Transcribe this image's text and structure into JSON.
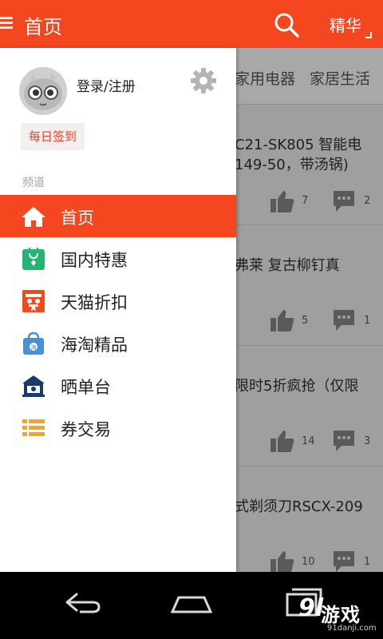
{
  "topbar": {
    "title": "首页",
    "featured_label": "精华",
    "accent_color": "#f4471f",
    "search_icon": "search-icon",
    "menu_icon": "hamburger-icon"
  },
  "background_tabs": [
    "家用电器",
    "家居生活"
  ],
  "background_items": [
    {
      "title_line1": "C21-SK805 智能电",
      "title_line2": "149-50，带汤锅)",
      "likes": "7",
      "comments": "2"
    },
    {
      "title_line1": "弗莱 复古柳钉真",
      "title_line2": "",
      "likes": "5",
      "comments": "1"
    },
    {
      "title_line1": "限时5折疯抢（仅限",
      "title_line2": "",
      "likes": "14",
      "comments": "3"
    },
    {
      "title_line1": "式剃须刀RSCX-209",
      "title_line2": "",
      "likes": "10",
      "comments": "1"
    }
  ],
  "drawer": {
    "login_label": "登录/注册",
    "checkin_label": "每日签到",
    "channel_header": "频道",
    "settings_icon": "gear-icon",
    "items": [
      {
        "label": "首页",
        "icon": "home-icon",
        "active": true
      },
      {
        "label": "国内特惠",
        "icon": "bag-icon",
        "active": false
      },
      {
        "label": "天猫折扣",
        "icon": "tmall-icon",
        "active": false
      },
      {
        "label": "海淘精品",
        "icon": "shopping-bag-icon",
        "active": false
      },
      {
        "label": "晒单台",
        "icon": "showcase-icon",
        "active": false
      },
      {
        "label": "券交易",
        "icon": "list-icon",
        "active": false
      }
    ]
  },
  "system_nav": {
    "back_icon": "back-icon",
    "home_icon": "home-icon",
    "recents_icon": "recents-icon"
  },
  "watermark": {
    "logo_text": "游戏",
    "logo_prefix": "9l",
    "site": "91danji.com"
  }
}
